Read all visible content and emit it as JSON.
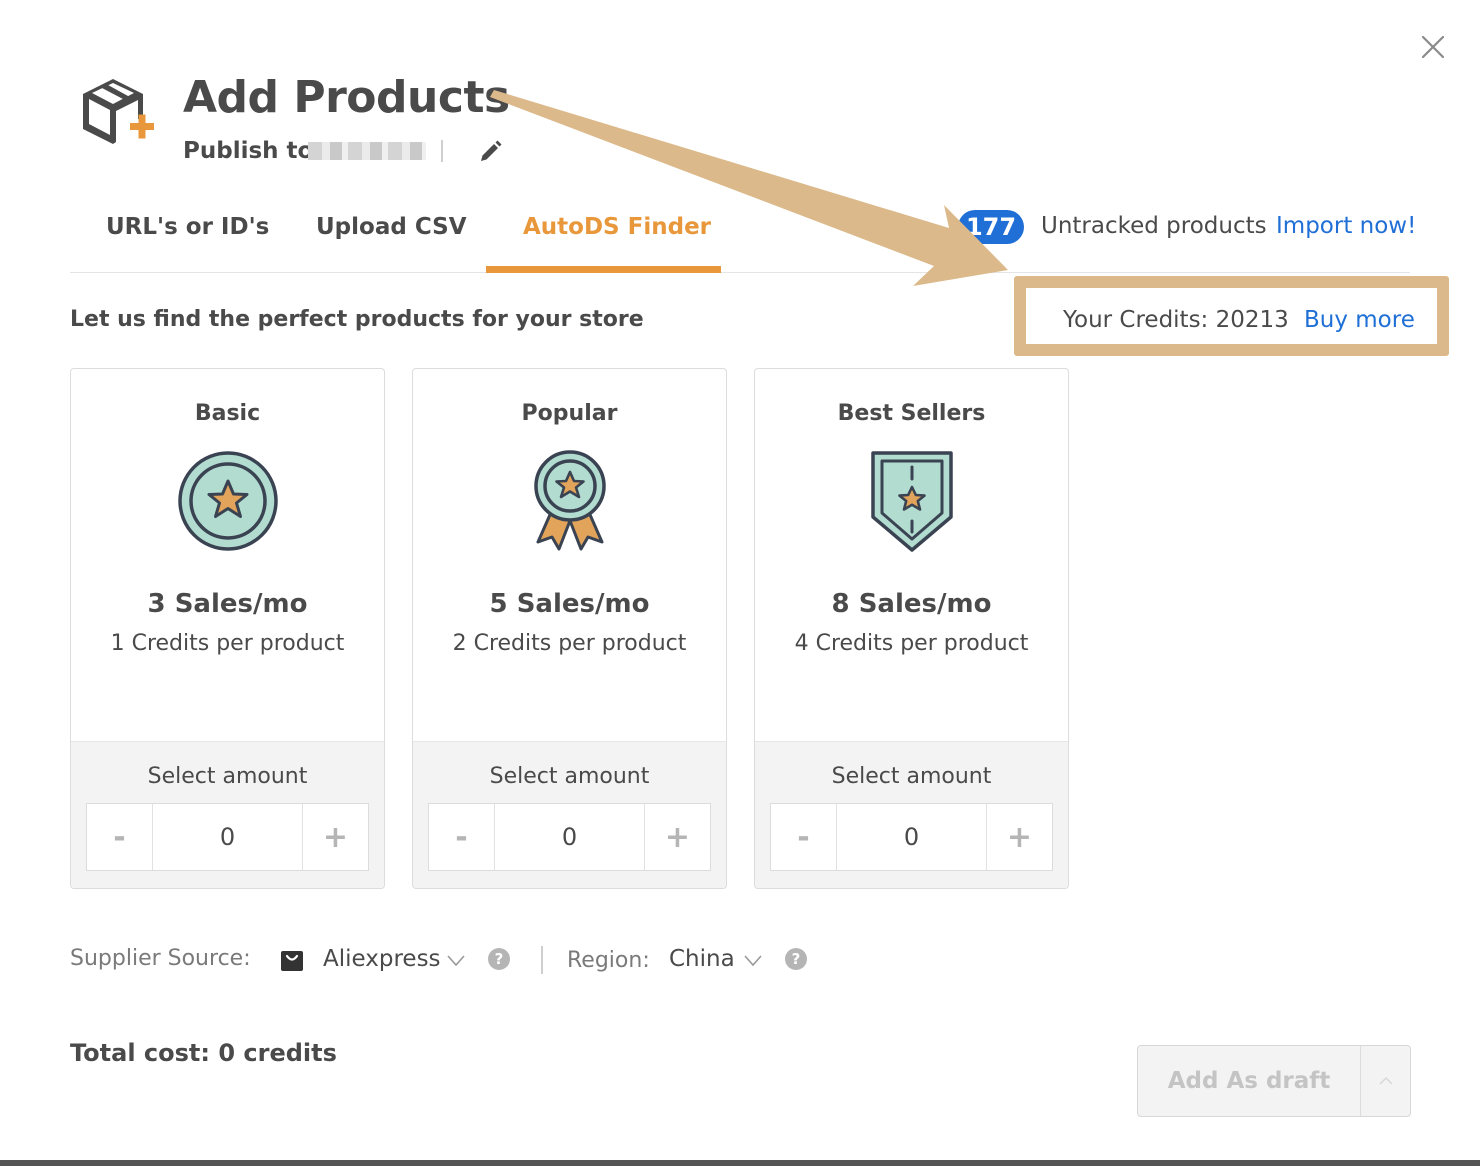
{
  "header": {
    "title": "Add Products",
    "publish_label": "Publish to:"
  },
  "tabs": [
    {
      "label": "URL's or ID's",
      "active": false
    },
    {
      "label": "Upload CSV",
      "active": false
    },
    {
      "label": "AutoDS Finder",
      "active": true
    }
  ],
  "untracked": {
    "count": "177",
    "label": "Untracked products",
    "link": "Import now!"
  },
  "subtitle": "Let us find the perfect products for your store",
  "credits": {
    "label": "Your Credits: 20213",
    "buy_link": "Buy more"
  },
  "cards": [
    {
      "title": "Basic",
      "icon": "star-medal-icon",
      "sales": "3 Sales/mo",
      "credits": "1 Credits per product",
      "select_label": "Select amount",
      "amount": "0",
      "minus": "-",
      "plus": "+"
    },
    {
      "title": "Popular",
      "icon": "award-ribbon-icon",
      "sales": "5 Sales/mo",
      "credits": "2 Credits per product",
      "select_label": "Select amount",
      "amount": "0",
      "minus": "-",
      "plus": "+"
    },
    {
      "title": "Best Sellers",
      "icon": "shield-star-icon",
      "sales": "8 Sales/mo",
      "credits": "4 Credits per product",
      "select_label": "Select amount",
      "amount": "0",
      "minus": "-",
      "plus": "+"
    }
  ],
  "filters": {
    "supplier_label": "Supplier Source:",
    "supplier_value": "Aliexpress",
    "region_label": "Region:",
    "region_value": "China",
    "help": "?"
  },
  "total": "Total cost: 0 credits",
  "actions": {
    "add_draft": "Add As draft"
  },
  "colors": {
    "accent": "#e8973a",
    "link": "#1f6fd6",
    "highlight": "#dcb98a",
    "icon_fill": "#b3dcd1",
    "icon_dark": "#3a4352",
    "icon_orange": "#e2a35a"
  }
}
